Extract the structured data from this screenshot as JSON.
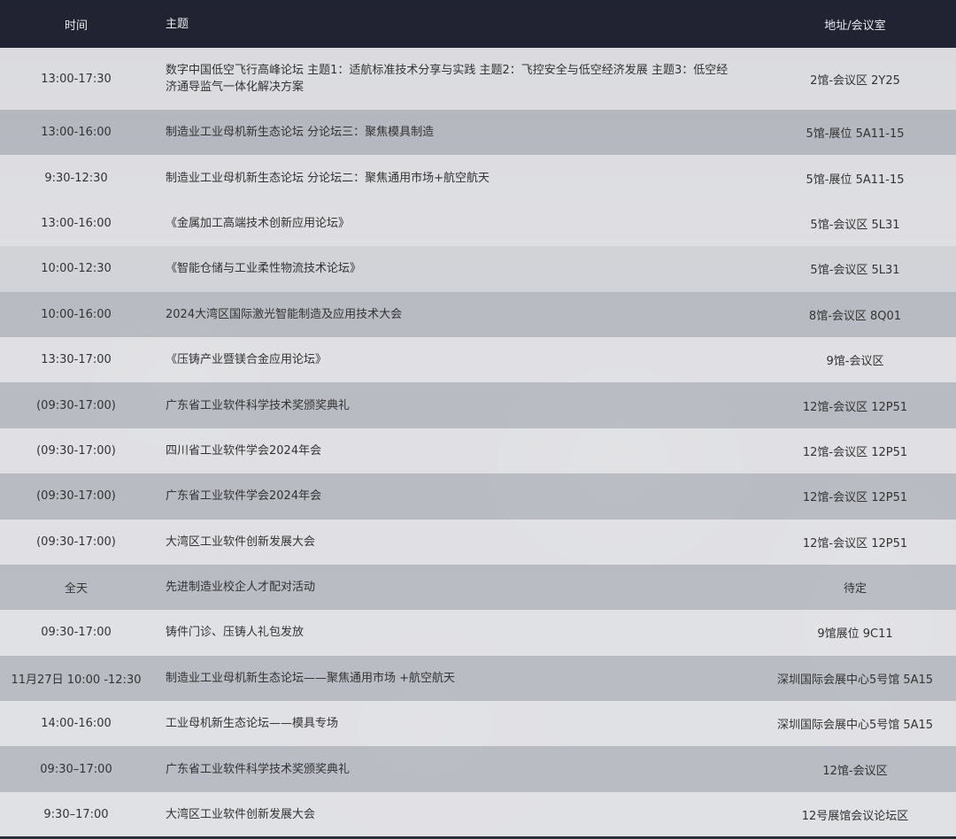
{
  "header": {
    "time": "时间",
    "topic": "主题",
    "location": "地址/会议室"
  },
  "rows": [
    {
      "time": "13:00-17:30",
      "topic": "数字中国低空飞行高峰论坛 主题1：适航标准技术分享与实践 主题2：飞控安全与低空经济发展 主题3：低空经济通导监气一体化解决方案",
      "location": "2馆-会议区 2Y25"
    },
    {
      "time": "13:00-16:00",
      "topic": "制造业工业母机新生态论坛 分论坛三：聚焦模具制造",
      "location": "5馆-展位 5A11-15"
    },
    {
      "time": "9:30-12:30",
      "topic": "制造业工业母机新生态论坛 分论坛二：聚焦通用市场+航空航天",
      "location": "5馆-展位 5A11-15"
    },
    {
      "time": "13:00-16:00",
      "topic": "《金属加工高端技术创新应用论坛》",
      "location": "5馆-会议区 5L31"
    },
    {
      "time": "10:00-12:30",
      "topic": "《智能仓储与工业柔性物流技术论坛》",
      "location": "5馆-会议区 5L31"
    },
    {
      "time": "10:00-16:00",
      "topic": "2024大湾区国际激光智能制造及应用技术大会",
      "location": "8馆-会议区 8Q01"
    },
    {
      "time": "13:30-17:00",
      "topic": "《压铸产业暨镁合金应用论坛》",
      "location": "9馆-会议区"
    },
    {
      "time": "(09:30-17:00)",
      "topic": "广东省工业软件科学技术奖颁奖典礼",
      "location": "12馆-会议区 12P51"
    },
    {
      "time": "(09:30-17:00)",
      "topic": "四川省工业软件学会2024年会",
      "location": "12馆-会议区 12P51"
    },
    {
      "time": "(09:30-17:00)",
      "topic": "广东省工业软件学会2024年会",
      "location": "12馆-会议区 12P51"
    },
    {
      "time": "(09:30-17:00)",
      "topic": "大湾区工业软件创新发展大会",
      "location": "12馆-会议区 12P51"
    },
    {
      "time": "全天",
      "topic": "先进制造业校企人才配对活动",
      "location": "待定"
    },
    {
      "time": "09:30-17:00",
      "topic": "铸件门诊、压铸人礼包发放",
      "location": "9馆展位 9C11"
    },
    {
      "time": "11月27日 10:00 -12:30",
      "topic": "制造业工业母机新生态论坛——聚焦通用市场 +航空航天",
      "location": "深圳国际会展中心5号馆 5A15"
    },
    {
      "time": "14:00-16:00",
      "topic": "工业母机新生态论坛——模具专场",
      "location": "深圳国际会展中心5号馆 5A15"
    },
    {
      "time": "09:30–17:00",
      "topic": "广东省工业软件科学技术奖颁奖典礼",
      "location": "12馆-会议区"
    },
    {
      "time": "9:30–17:00",
      "topic": "大湾区工业软件创新发展大会",
      "location": "12号展馆会议论坛区"
    }
  ]
}
